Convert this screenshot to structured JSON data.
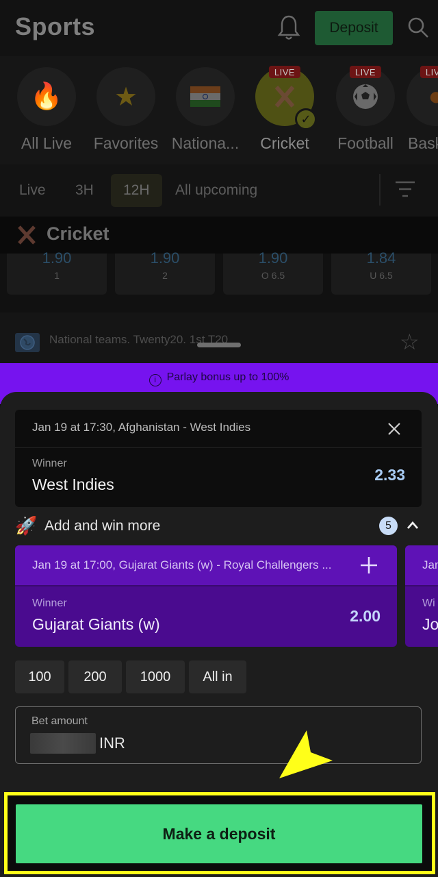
{
  "header": {
    "title": "Sports",
    "deposit_label": "Deposit"
  },
  "categories": [
    {
      "label": "All Live",
      "icon": "fire-icon",
      "live": false,
      "active": false
    },
    {
      "label": "Favorites",
      "icon": "star-icon",
      "live": false,
      "active": false
    },
    {
      "label": "Nationa...",
      "icon": "india-flag-icon",
      "live": false,
      "active": false
    },
    {
      "label": "Cricket",
      "icon": "cricket-bats-icon",
      "live": true,
      "active": true
    },
    {
      "label": "Football",
      "icon": "soccer-ball-icon",
      "live": true,
      "active": false
    },
    {
      "label": "Bask",
      "icon": "basketball-icon",
      "live": true,
      "active": false
    }
  ],
  "live_tag": "LIVE",
  "time_filters": [
    {
      "label": "Live",
      "active": false
    },
    {
      "label": "3H",
      "active": false
    },
    {
      "label": "12H",
      "active": true
    },
    {
      "label": "All upcoming",
      "active": false
    }
  ],
  "section": {
    "title": "Cricket",
    "odds": [
      {
        "value": "1.90",
        "label": "1"
      },
      {
        "value": "1.90",
        "label": "2"
      },
      {
        "value": "1.90",
        "label": "O 6.5"
      },
      {
        "value": "1.84",
        "label": "U 6.5"
      }
    ],
    "next_match": "National teams. Twenty20. 1st T20"
  },
  "betslip": {
    "promo": "Parlay bonus up to 100%",
    "bet": {
      "event": "Jan 19 at 17:30, Afghanistan - West Indies",
      "market": "Winner",
      "pick": "West Indies",
      "odds": "2.33"
    },
    "add_win_more": {
      "label": "Add and win more",
      "count": "5"
    },
    "suggestions": [
      {
        "event": "Jan 19 at 17:00, Gujarat Giants (w) - Royal Challengers ...",
        "market": "Winner",
        "pick": "Gujarat Giants (w)",
        "odds": "2.00"
      },
      {
        "event": "Jan",
        "market": "Wi",
        "pick": "Jo",
        "odds": ""
      }
    ],
    "quick_amounts": [
      "100",
      "200",
      "1000",
      "All in"
    ],
    "amount": {
      "label": "Bet amount",
      "currency": "INR"
    },
    "cta": "Make a deposit"
  },
  "colors": {
    "accent_green": "#46d981",
    "promo_purple": "#7613ef",
    "suggestion_purple": "#4a0b8f",
    "odds_blue": "#a9cdf6",
    "highlight_yellow": "#ffff19"
  }
}
